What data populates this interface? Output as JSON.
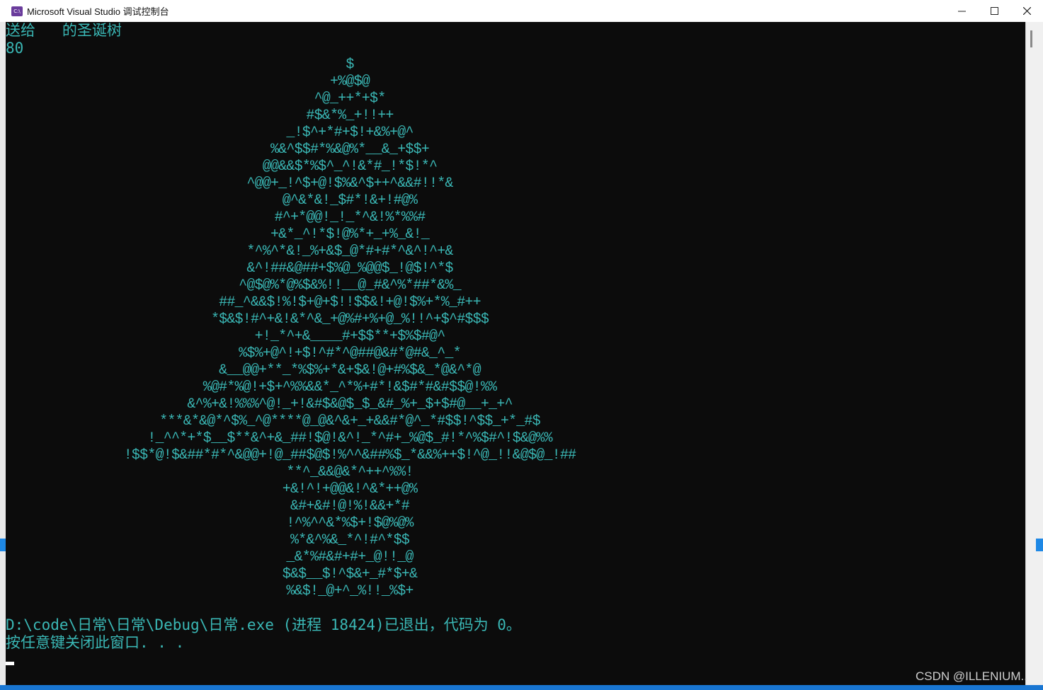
{
  "window": {
    "title": "Microsoft Visual Studio 调试控制台",
    "icon": "visual-studio-console-icon",
    "controls": {
      "minimize": "—",
      "maximize": "☐",
      "close": "✕"
    }
  },
  "console": {
    "header_line_1": "送给   的圣诞树",
    "header_line_2": "80",
    "tree": [
      "$",
      "+%@$@",
      "^@_++*+$*",
      "#$&*%_+!!++",
      "_!$^+*#+$!+&%+@^",
      "%&^$$#*%&@%*__&_+$$+",
      "@@&&$*%$^_^!&*#_!*$!*^",
      "^@@+_!^$+@!$%&^$++^&&#!!*&",
      "@^&*&!_$#*!&+!#@%",
      "#^+*@@!_!_*^&!%*%%#",
      "+&*_^!*$!@%*+_+%_&!_",
      "*^%^*&!_%+&$_@*#+#*^&^!^+&",
      "&^!##&@##+$%@_%@@$_!@$!^*$",
      "^@$@%*@%$&%!!__@_#&^%*##*&%_",
      "##_^&&$!%!$+@+$!!$$&!+@!$%+*%_#++",
      "*$&$!#^+&!&*^&_+@%#+%+@_%!!^+$^#$$$",
      "+!_*^+&____#+$$**+$%$#@^",
      "%$%+@^!+$!^#*^@##@&#*@#&_^_*",
      "&__@@+**_*%$%+*&+$&!@+#%$&_*@&^*@",
      "%@#*%@!+$+^%%&&*_^*%+#*!&$#*#&#$$@!%%",
      "&^%+&!%%%^@!_+!&#$&@$_$_&#_%+_$+$#@__+_+^",
      "***&*&@*^$%_^@****@_@&^&+_+&&#*@^_*#$$!^$$_+*_#$",
      "!_^^*+*$__$**&^+&_##!$@!&^!_*^#+_%@$_#!*^%$#^!$&@%%",
      "!$$*@!$&##*#*^&@@+!@_##$@$!%^^&##%$_*&&%++$!^@_!!&@$@_!##",
      "**^_&&@&*^++^%%!",
      "+&!^!+@@&!^&*++@%",
      "&#+&#!@!%!&&+*#",
      "!^%^^&*%$+!$@%@%",
      "%*&^%&_*^!#^*$$",
      "_&*%#&#+#+_@!!_@",
      "$&$__$!^$&+_#*$+&",
      "%&$!_@+^_%!!_%$+"
    ],
    "exit_line": "D:\\code\\日常\\日常\\Debug\\日常.exe (进程 18424)已退出，代码为 0。",
    "prompt_line": "按任意键关闭此窗口. . ."
  },
  "watermark": "CSDN @ILLENIUM..",
  "colors": {
    "console_text": "#3ab7b5",
    "console_bg": "#0c0c0c",
    "titlebar_bg": "#ffffff",
    "accent_blue": "#1976d2"
  }
}
